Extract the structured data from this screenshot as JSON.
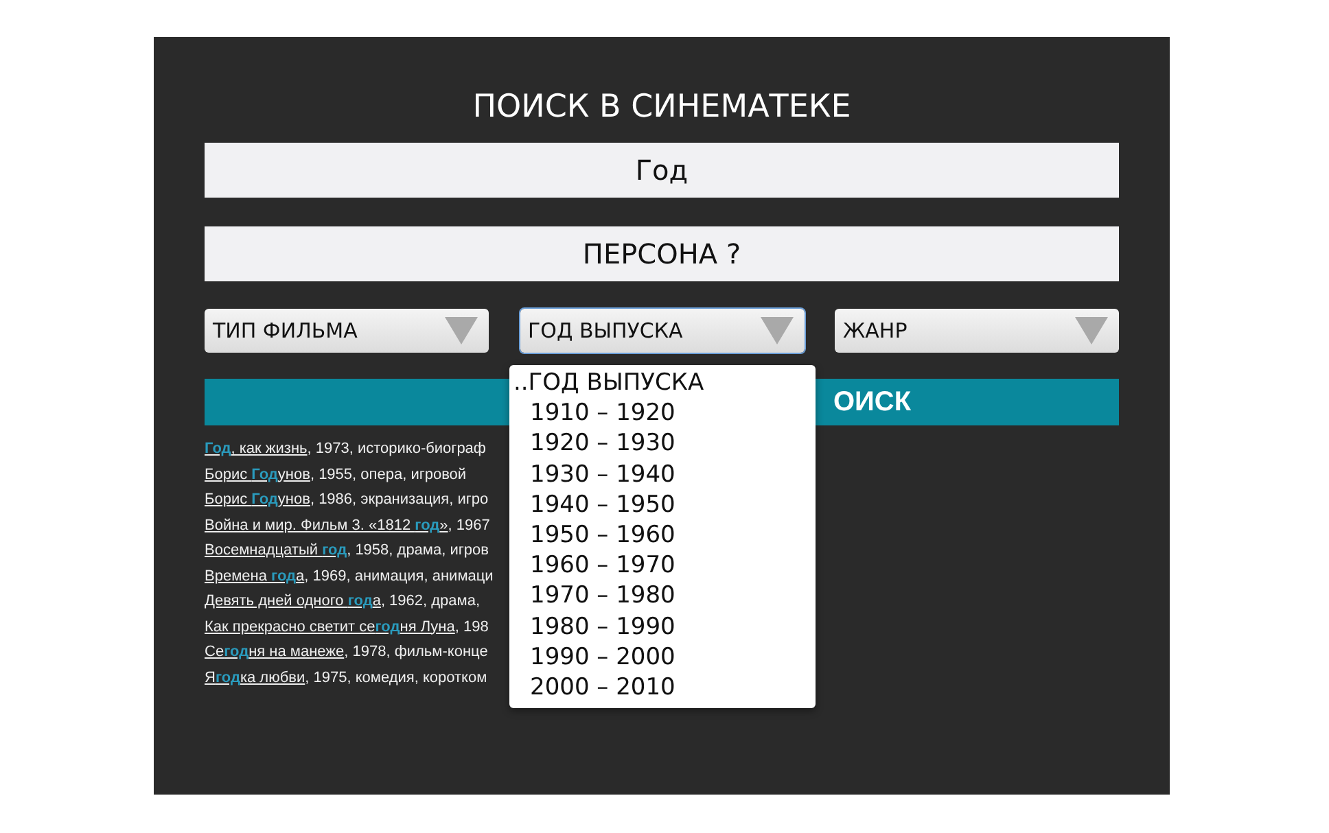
{
  "title": "ПОИСК В СИНЕМАТЕКЕ",
  "fields": [
    {
      "value": "Год"
    },
    {
      "value": "ПЕРСОНА ?"
    }
  ],
  "filters": [
    {
      "label": "ТИП ФИЛЬМА",
      "expanded": false
    },
    {
      "label": "ГОД ВЫПУСКА",
      "expanded": true
    },
    {
      "label": "ЖАНР",
      "expanded": false
    }
  ],
  "dropdown": {
    "options": [
      {
        "label": "..ГОД ВЫПУСКА",
        "selected": false
      },
      {
        "label": "1910 – 1920",
        "selected": false
      },
      {
        "label": "1920 – 1930",
        "selected": false
      },
      {
        "label": "1930 – 1940",
        "selected": false
      },
      {
        "label": "1940 – 1950",
        "selected": false
      },
      {
        "label": "1950 – 1960",
        "selected": false
      },
      {
        "label": "1960 – 1970",
        "selected": false
      },
      {
        "label": "1970 – 1980",
        "selected": false
      },
      {
        "label": "1980 – 1990",
        "selected": false
      },
      {
        "label": "1990 – 2000",
        "selected": false
      },
      {
        "label": "2000 – 2010",
        "selected": false
      }
    ]
  },
  "search_button": {
    "label": "ОИСК"
  },
  "results": [
    {
      "title": "**Год**, как жизнь",
      "details": ", 1973, историко-биограф"
    },
    {
      "title": "Борис **Год**унов",
      "details": ", 1955, опера, игровой"
    },
    {
      "title": "Борис **Год**унов",
      "details": ", 1986, экранизация, игро"
    },
    {
      "title": "Война и мир. Фильм 3. «1812 **год**»",
      "details": ", 1967"
    },
    {
      "title": "Восемнадцатый **год**",
      "details": ", 1958, драма, игров"
    },
    {
      "title": "Времена **год**а",
      "details": ", 1969, анимация, анимаци"
    },
    {
      "title": "Девять дней одного **год**а",
      "details": ", 1962, драма,"
    },
    {
      "title": "Как прекрасно светит се**год**ня Луна",
      "details": ", 198"
    },
    {
      "title": "Се**год**ня на манеже",
      "details": ", 1978, фильм-конце"
    },
    {
      "title": "Я**год**ка любви",
      "details": ", 1975, комедия, коротком"
    }
  ]
}
